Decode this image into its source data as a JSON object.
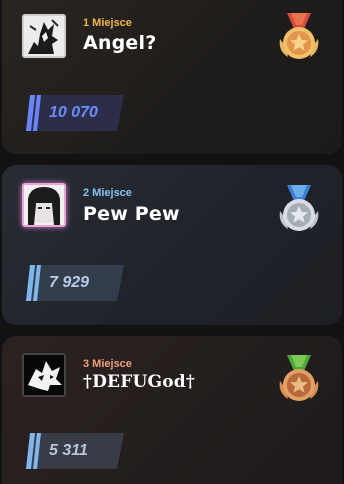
{
  "leaderboard": [
    {
      "place_label": "1 Miejsce",
      "name": "Angel?",
      "score": "10 070",
      "medal_icon": "gold-medal-icon",
      "avatar_icon": "user-avatar-angel",
      "accent": "#f0b64a"
    },
    {
      "place_label": "2 Miejsce",
      "name": "Pew Pew",
      "score": "7 929",
      "medal_icon": "silver-medal-icon",
      "avatar_icon": "user-avatar-pewpew",
      "accent": "#88c2f0"
    },
    {
      "place_label": "3 Miejsce",
      "name": "†DEFUGod†",
      "score": "5 311",
      "medal_icon": "bronze-medal-icon",
      "avatar_icon": "user-avatar-defu",
      "accent": "#f0a07a"
    }
  ]
}
